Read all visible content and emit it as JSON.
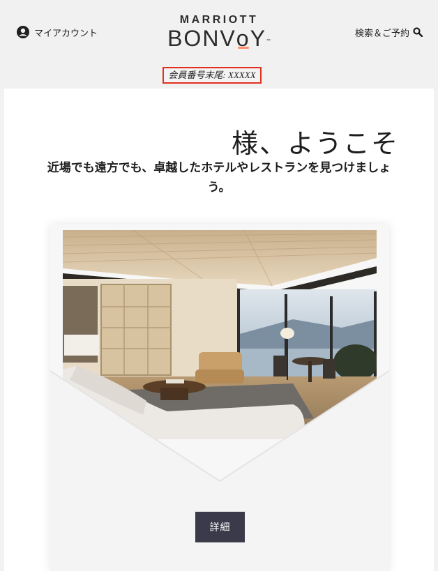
{
  "header": {
    "account_label": "マイアカウント",
    "logo_top": "MARRIOTT",
    "logo_main_part1": "BONV",
    "logo_main_accent": "o",
    "logo_main_part2": "Y",
    "logo_tm": "™",
    "search_label": "検索＆ご予約",
    "member_number": "会員番号末尾: XXXXX",
    "member_highlight_color": "#e0301e"
  },
  "main": {
    "welcome": "様、ようこそ",
    "subtitle": "近場でも遠方でも、卓越したホテルやレストランを見つけましょう。",
    "details_button": "詳細"
  },
  "colors": {
    "accent": "#ff8d6b",
    "button": "#3a3a4a"
  }
}
